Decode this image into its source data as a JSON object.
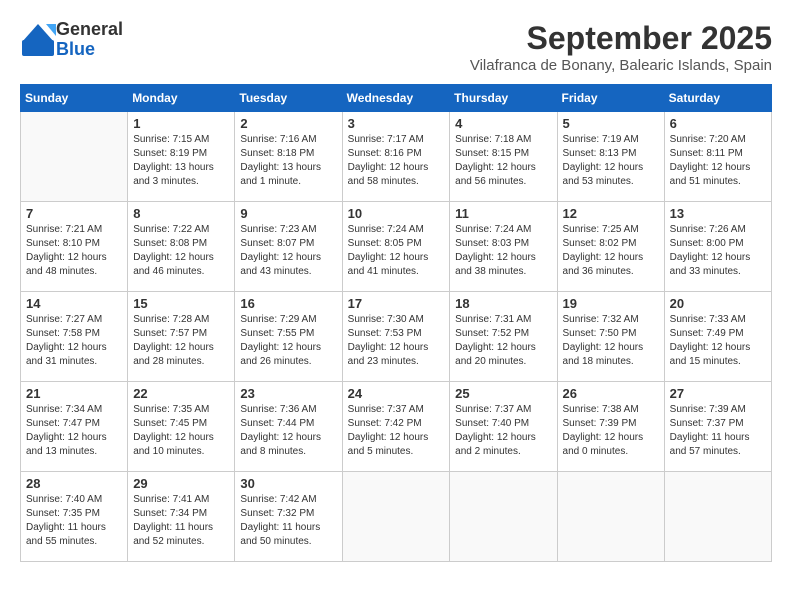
{
  "header": {
    "logo_general": "General",
    "logo_blue": "Blue",
    "month": "September 2025",
    "location": "Vilafranca de Bonany, Balearic Islands, Spain"
  },
  "days_of_week": [
    "Sunday",
    "Monday",
    "Tuesday",
    "Wednesday",
    "Thursday",
    "Friday",
    "Saturday"
  ],
  "weeks": [
    [
      {
        "day": "",
        "info": ""
      },
      {
        "day": "1",
        "info": "Sunrise: 7:15 AM\nSunset: 8:19 PM\nDaylight: 13 hours\nand 3 minutes."
      },
      {
        "day": "2",
        "info": "Sunrise: 7:16 AM\nSunset: 8:18 PM\nDaylight: 13 hours\nand 1 minute."
      },
      {
        "day": "3",
        "info": "Sunrise: 7:17 AM\nSunset: 8:16 PM\nDaylight: 12 hours\nand 58 minutes."
      },
      {
        "day": "4",
        "info": "Sunrise: 7:18 AM\nSunset: 8:15 PM\nDaylight: 12 hours\nand 56 minutes."
      },
      {
        "day": "5",
        "info": "Sunrise: 7:19 AM\nSunset: 8:13 PM\nDaylight: 12 hours\nand 53 minutes."
      },
      {
        "day": "6",
        "info": "Sunrise: 7:20 AM\nSunset: 8:11 PM\nDaylight: 12 hours\nand 51 minutes."
      }
    ],
    [
      {
        "day": "7",
        "info": "Sunrise: 7:21 AM\nSunset: 8:10 PM\nDaylight: 12 hours\nand 48 minutes."
      },
      {
        "day": "8",
        "info": "Sunrise: 7:22 AM\nSunset: 8:08 PM\nDaylight: 12 hours\nand 46 minutes."
      },
      {
        "day": "9",
        "info": "Sunrise: 7:23 AM\nSunset: 8:07 PM\nDaylight: 12 hours\nand 43 minutes."
      },
      {
        "day": "10",
        "info": "Sunrise: 7:24 AM\nSunset: 8:05 PM\nDaylight: 12 hours\nand 41 minutes."
      },
      {
        "day": "11",
        "info": "Sunrise: 7:24 AM\nSunset: 8:03 PM\nDaylight: 12 hours\nand 38 minutes."
      },
      {
        "day": "12",
        "info": "Sunrise: 7:25 AM\nSunset: 8:02 PM\nDaylight: 12 hours\nand 36 minutes."
      },
      {
        "day": "13",
        "info": "Sunrise: 7:26 AM\nSunset: 8:00 PM\nDaylight: 12 hours\nand 33 minutes."
      }
    ],
    [
      {
        "day": "14",
        "info": "Sunrise: 7:27 AM\nSunset: 7:58 PM\nDaylight: 12 hours\nand 31 minutes."
      },
      {
        "day": "15",
        "info": "Sunrise: 7:28 AM\nSunset: 7:57 PM\nDaylight: 12 hours\nand 28 minutes."
      },
      {
        "day": "16",
        "info": "Sunrise: 7:29 AM\nSunset: 7:55 PM\nDaylight: 12 hours\nand 26 minutes."
      },
      {
        "day": "17",
        "info": "Sunrise: 7:30 AM\nSunset: 7:53 PM\nDaylight: 12 hours\nand 23 minutes."
      },
      {
        "day": "18",
        "info": "Sunrise: 7:31 AM\nSunset: 7:52 PM\nDaylight: 12 hours\nand 20 minutes."
      },
      {
        "day": "19",
        "info": "Sunrise: 7:32 AM\nSunset: 7:50 PM\nDaylight: 12 hours\nand 18 minutes."
      },
      {
        "day": "20",
        "info": "Sunrise: 7:33 AM\nSunset: 7:49 PM\nDaylight: 12 hours\nand 15 minutes."
      }
    ],
    [
      {
        "day": "21",
        "info": "Sunrise: 7:34 AM\nSunset: 7:47 PM\nDaylight: 12 hours\nand 13 minutes."
      },
      {
        "day": "22",
        "info": "Sunrise: 7:35 AM\nSunset: 7:45 PM\nDaylight: 12 hours\nand 10 minutes."
      },
      {
        "day": "23",
        "info": "Sunrise: 7:36 AM\nSunset: 7:44 PM\nDaylight: 12 hours\nand 8 minutes."
      },
      {
        "day": "24",
        "info": "Sunrise: 7:37 AM\nSunset: 7:42 PM\nDaylight: 12 hours\nand 5 minutes."
      },
      {
        "day": "25",
        "info": "Sunrise: 7:37 AM\nSunset: 7:40 PM\nDaylight: 12 hours\nand 2 minutes."
      },
      {
        "day": "26",
        "info": "Sunrise: 7:38 AM\nSunset: 7:39 PM\nDaylight: 12 hours\nand 0 minutes."
      },
      {
        "day": "27",
        "info": "Sunrise: 7:39 AM\nSunset: 7:37 PM\nDaylight: 11 hours\nand 57 minutes."
      }
    ],
    [
      {
        "day": "28",
        "info": "Sunrise: 7:40 AM\nSunset: 7:35 PM\nDaylight: 11 hours\nand 55 minutes."
      },
      {
        "day": "29",
        "info": "Sunrise: 7:41 AM\nSunset: 7:34 PM\nDaylight: 11 hours\nand 52 minutes."
      },
      {
        "day": "30",
        "info": "Sunrise: 7:42 AM\nSunset: 7:32 PM\nDaylight: 11 hours\nand 50 minutes."
      },
      {
        "day": "",
        "info": ""
      },
      {
        "day": "",
        "info": ""
      },
      {
        "day": "",
        "info": ""
      },
      {
        "day": "",
        "info": ""
      }
    ]
  ]
}
